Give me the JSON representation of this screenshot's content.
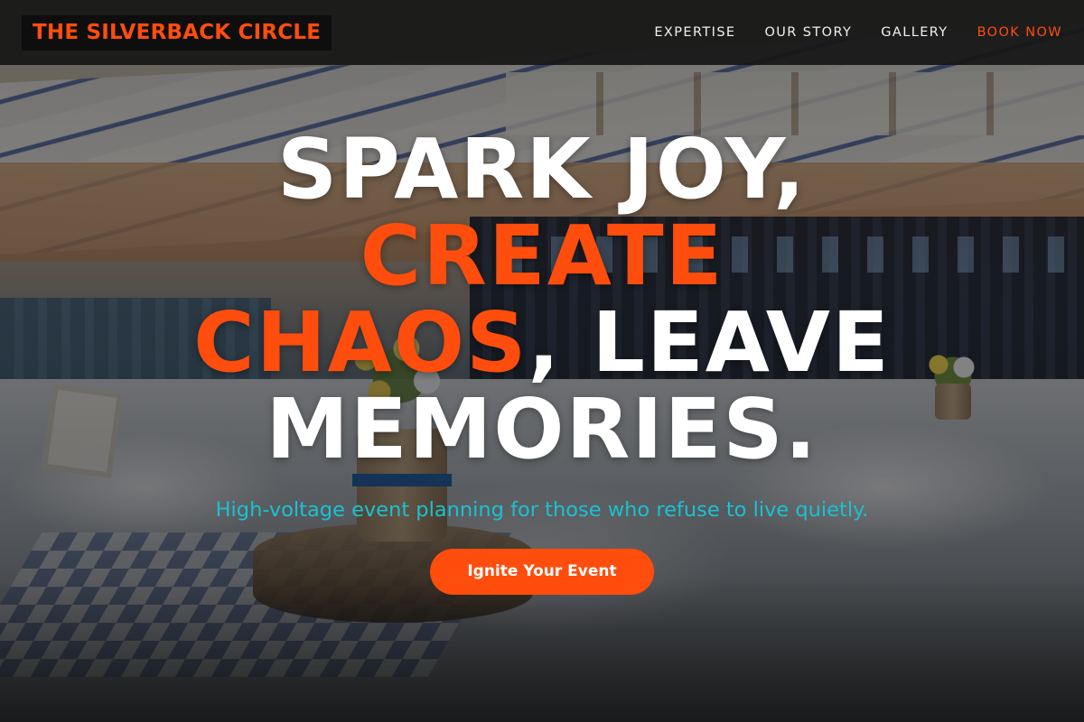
{
  "header": {
    "logo": "THE SILVERBACK CIRCLE",
    "nav": [
      {
        "label": "EXPERTISE"
      },
      {
        "label": "OUR STORY"
      },
      {
        "label": "GALLERY"
      },
      {
        "label": "BOOK NOW"
      }
    ]
  },
  "hero": {
    "headline": {
      "part1": "SPARK JOY, ",
      "highlight": "CREATE CHAOS",
      "part2": ", LEAVE MEMORIES."
    },
    "subtitle": "High-voltage event planning for those who refuse to live quietly.",
    "cta_label": "Ignite Your Event"
  },
  "colors": {
    "accent": "#ff4d0d",
    "subtitle": "#19c2d2",
    "header_bg": "#161616"
  }
}
